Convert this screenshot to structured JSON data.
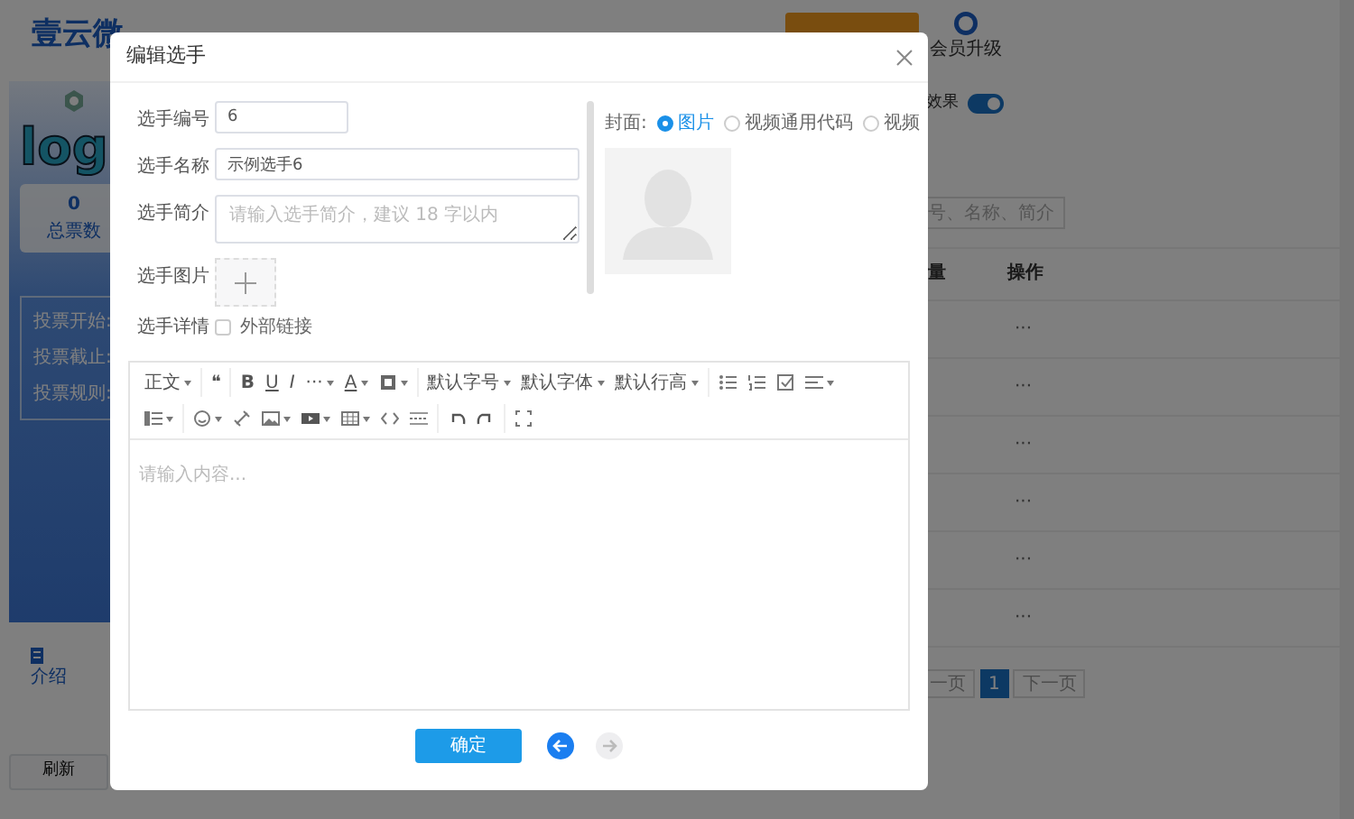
{
  "background": {
    "brand": "壹云微",
    "upgrade_label": "会员升级",
    "sidebar": {
      "logo_text": "log",
      "stat_value": "0",
      "stat_label": "总票数",
      "info": [
        "投票开始:",
        "投票截止:",
        "投票规则:"
      ],
      "tab": "介绍",
      "refresh_button": "刷新"
    },
    "effect_toggle": {
      "label": "效果",
      "on": true
    },
    "search": {
      "placeholder": "号、名称、简介"
    },
    "columns": [
      "量",
      "操作"
    ],
    "rows": [
      {
        "action": "···"
      },
      {
        "action": "···"
      },
      {
        "action": "···"
      },
      {
        "action": "···"
      },
      {
        "action": "···"
      },
      {
        "action": "···"
      }
    ],
    "pagination": [
      {
        "label": "一页",
        "selected": false
      },
      {
        "label": "1",
        "selected": true
      },
      {
        "label": "下一页",
        "selected": false
      }
    ]
  },
  "modal": {
    "title": "编辑选手",
    "fields": [
      {
        "label": "选手编号",
        "kind": "input",
        "value": "6"
      },
      {
        "label": "选手名称",
        "kind": "input",
        "value": "示例选手6"
      },
      {
        "label": "选手简介",
        "kind": "textarea",
        "placeholder": "请输入选手简介，建议 18 字以内"
      },
      {
        "label": "选手图片",
        "kind": "upload"
      },
      {
        "label": "选手详情",
        "kind": "checkbox",
        "option": "外部链接",
        "checked": false
      }
    ],
    "cover": {
      "label": "封面:",
      "options": [
        {
          "label": "图片",
          "selected": true
        },
        {
          "label": "视频通用代码",
          "selected": false
        },
        {
          "label": "视频",
          "selected": false
        }
      ]
    },
    "editor": {
      "toolbar": [
        [
          [
            {
              "kind": "text",
              "label": "正文",
              "dropdown": true
            }
          ],
          [
            {
              "kind": "text",
              "label": "❝",
              "dropdown": false
            }
          ],
          [
            {
              "kind": "bold",
              "label": "B",
              "dropdown": false
            },
            {
              "kind": "underline",
              "label": "U",
              "dropdown": false
            },
            {
              "kind": "italic",
              "label": "I",
              "dropdown": false
            },
            {
              "kind": "text",
              "label": "···",
              "dropdown": true
            },
            {
              "kind": "underline",
              "label": "A",
              "dropdown": true
            },
            {
              "kind": "icon",
              "dropdown": true
            }
          ],
          [
            {
              "kind": "text",
              "label": "默认字号",
              "dropdown": true
            },
            {
              "kind": "text",
              "label": "默认字体",
              "dropdown": true
            },
            {
              "kind": "text",
              "label": "默认行高",
              "dropdown": true
            }
          ],
          [
            {
              "kind": "icon",
              "dropdown": false
            },
            {
              "kind": "icon",
              "dropdown": false
            },
            {
              "kind": "icon",
              "dropdown": false
            },
            {
              "kind": "icon",
              "dropdown": true
            }
          ]
        ],
        [
          [
            {
              "kind": "icon",
              "dropdown": true
            }
          ],
          [
            {
              "kind": "icon",
              "dropdown": true
            },
            {
              "kind": "icon",
              "dropdown": false
            },
            {
              "kind": "icon",
              "dropdown": true
            },
            {
              "kind": "icon",
              "dropdown": true
            },
            {
              "kind": "icon",
              "dropdown": true
            },
            {
              "kind": "icon",
              "dropdown": false
            },
            {
              "kind": "icon",
              "dropdown": false
            }
          ],
          [
            {
              "kind": "icon",
              "dropdown": false
            },
            {
              "kind": "icon",
              "dropdown": false
            }
          ],
          [
            {
              "kind": "icon",
              "dropdown": false
            }
          ]
        ]
      ],
      "placeholder": "请输入内容..."
    },
    "confirm_button": "确定",
    "steps": [
      {
        "disabled": false
      },
      {
        "disabled": true
      }
    ]
  }
}
